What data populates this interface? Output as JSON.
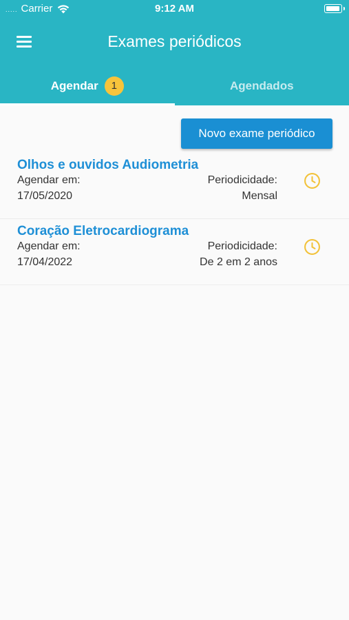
{
  "status_bar": {
    "carrier": "Carrier",
    "time": "9:12 AM",
    "signal_dots": "....."
  },
  "app_bar": {
    "title": "Exames periódicos",
    "menu_icon": "menu-icon"
  },
  "tabs": [
    {
      "label": "Agendar",
      "badge": "1",
      "active": true
    },
    {
      "label": "Agendados",
      "active": false
    }
  ],
  "actions": {
    "new_exam_label": "Novo exame periódico"
  },
  "exams": [
    {
      "title": "Olhos e ouvidos Audiometria",
      "schedule_label": "Agendar em:",
      "date": "17/05/2020",
      "period_label": "Periodicidade:",
      "period": "Mensal",
      "icon": "clock-icon"
    },
    {
      "title": "Coração Eletrocardiograma",
      "schedule_label": "Agendar em:",
      "date": "17/04/2022",
      "period_label": "Periodicidade:",
      "period": "De 2 em 2 anos",
      "icon": "clock-icon"
    }
  ],
  "colors": {
    "primary": "#29b5c4",
    "button": "#1a8fd3",
    "link": "#1e8fd6",
    "badge": "#f7c43b",
    "clock": "#f2c23a"
  }
}
